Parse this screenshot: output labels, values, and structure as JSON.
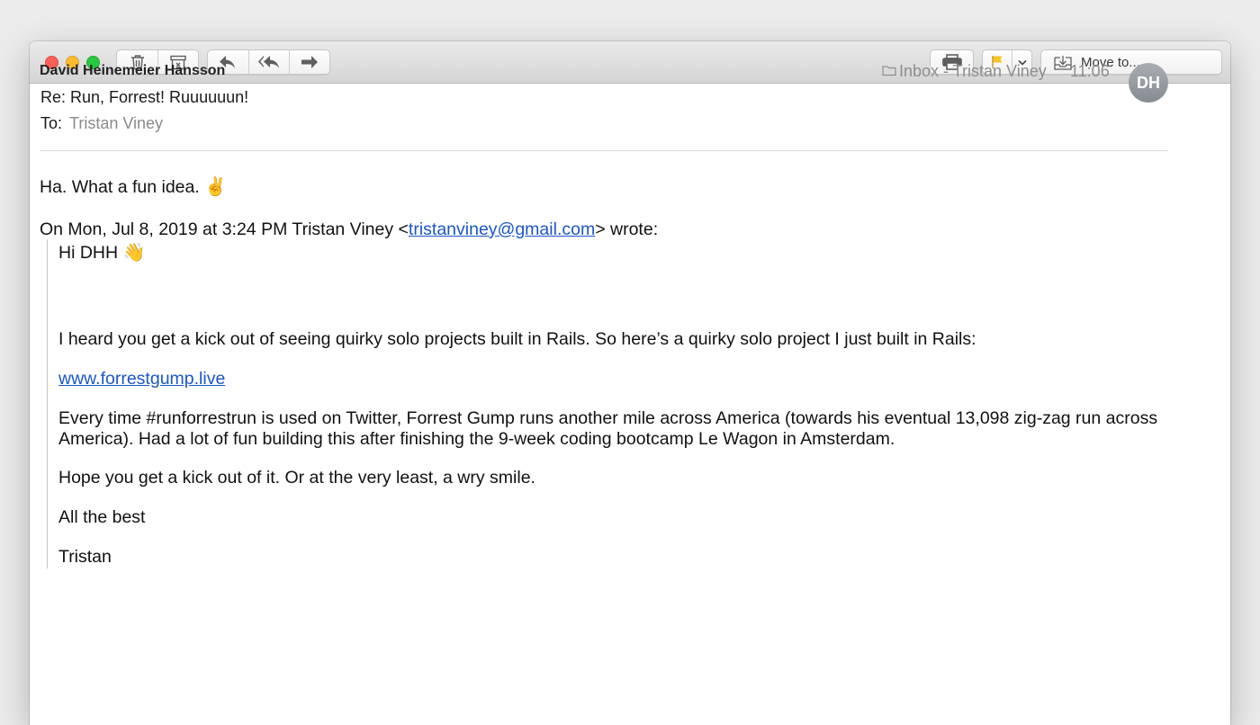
{
  "toolbar": {
    "buttons": [
      {
        "name": "delete",
        "icon": "trash-icon"
      },
      {
        "name": "junk",
        "icon": "archive-icon"
      },
      {
        "name": "reply",
        "icon": "reply-icon"
      },
      {
        "name": "reply-all",
        "icon": "reply-all-icon"
      },
      {
        "name": "forward",
        "icon": "forward-icon"
      },
      {
        "name": "print",
        "icon": "printer-icon"
      },
      {
        "name": "flag",
        "icon": "flag-icon"
      },
      {
        "name": "flag-menu",
        "icon": "chevron-down-icon"
      }
    ],
    "move_label": "Move to...",
    "flag_color": "#f6c324"
  },
  "message": {
    "sender": "David Heinemeier Hansson",
    "subject": "Re: Run, Forrest! Ruuuuuun!",
    "to_label": "To:",
    "to_value": "Tristan Viney",
    "mailbox": "Inbox - Tristan Viney",
    "time": "11:06",
    "avatar_initials": "DH"
  },
  "body": {
    "reply_text": "Ha. What a fun idea.",
    "reply_emoji": "✌️",
    "quote_head_prefix": "On Mon, Jul 8, 2019 at 3:24 PM Tristan Viney <",
    "quote_head_email": "tristanviney@gmail.com",
    "quote_head_suffix": "> wrote:",
    "quote": {
      "greeting": "Hi DHH",
      "greeting_emoji": "👋",
      "p1": "I heard you get a kick out of seeing quirky solo projects built in Rails. So here’s a quirky solo project I just built in Rails:",
      "link": "www.forrestgump.live",
      "p2": "Every time #runforrestrun is used on Twitter, Forrest Gump runs another mile across America (towards his eventual 13,098 zig-zag run across America). Had a lot of fun building this after finishing the 9-week coding bootcamp Le Wagon in Amsterdam.",
      "p3": "Hope you get a kick out of it. Or at the very least, a wry smile.",
      "p4": "All the best",
      "signature": "Tristan"
    }
  },
  "colors": {
    "link": "#1a56c8",
    "close": "#fc5f57",
    "minimize": "#fdbc2e",
    "zoom": "#28c840"
  }
}
